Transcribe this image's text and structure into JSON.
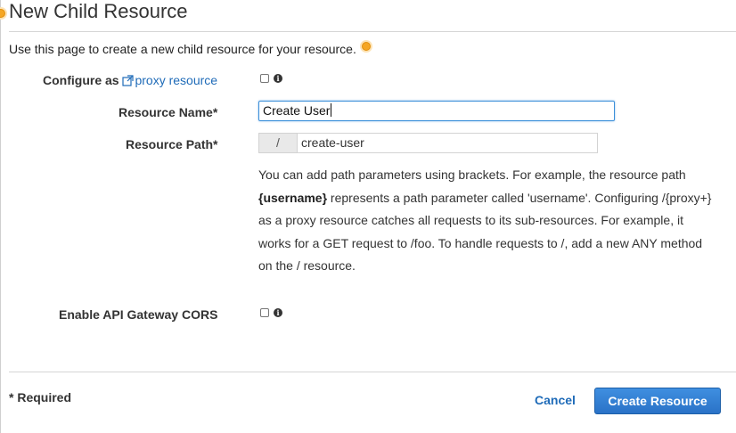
{
  "page": {
    "title": "New Child Resource",
    "intro": "Use this page to create a new child resource for your resource."
  },
  "form": {
    "configure_as_label": "Configure as",
    "proxy_link": "proxy resource",
    "proxy_checked": false,
    "resource_name_label": "Resource Name*",
    "resource_name_value": "Create User",
    "resource_path_label": "Resource Path*",
    "resource_path_prefix": "/",
    "resource_path_value": "create-user",
    "help": {
      "part1": "You can add path parameters using brackets. For example, the resource path ",
      "bold": "{username}",
      "part2": " represents a path parameter called 'username'. Configuring /{proxy+} as a proxy resource catches all requests to its sub-resources. For example, it works for a GET request to /foo. To handle requests to /, add a new ANY method on the / resource."
    },
    "cors_label": "Enable API Gateway CORS",
    "cors_checked": false
  },
  "footer": {
    "required_note": "* Required",
    "cancel_label": "Cancel",
    "create_label": "Create Resource"
  },
  "icons": {
    "external_link": "external-link-icon",
    "info": "info-icon",
    "highlight_marker": "orange-marker-icon"
  },
  "colors": {
    "link": "#1f6bb8",
    "primary_button": "#2f7fd3",
    "focus_border": "#3b8fd9",
    "marker": "#f5a623"
  }
}
